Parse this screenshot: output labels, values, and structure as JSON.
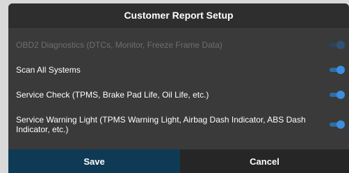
{
  "dialog": {
    "title": "Customer Report Setup",
    "items": [
      {
        "label": "OBD2 Diagnostics (DTCs, Monitor, Freeze Frame Data)",
        "enabled": false,
        "state": "on"
      },
      {
        "label": "Scan All Systems",
        "enabled": true,
        "state": "on"
      },
      {
        "label": "Service Check (TPMS, Brake Pad Life, Oil Life, etc.)",
        "enabled": true,
        "state": "on"
      },
      {
        "label": "Service Warning Light (TPMS Warning Light, Airbag Dash Indicator, ABS Dash Indicator, etc.)",
        "enabled": true,
        "state": "on"
      }
    ],
    "save_label": "Save",
    "cancel_label": "Cancel"
  },
  "colors": {
    "dialog_bg": "#3a3a3a",
    "save_bg": "#0f3a55",
    "toggle_on": "#3a8fe0"
  }
}
